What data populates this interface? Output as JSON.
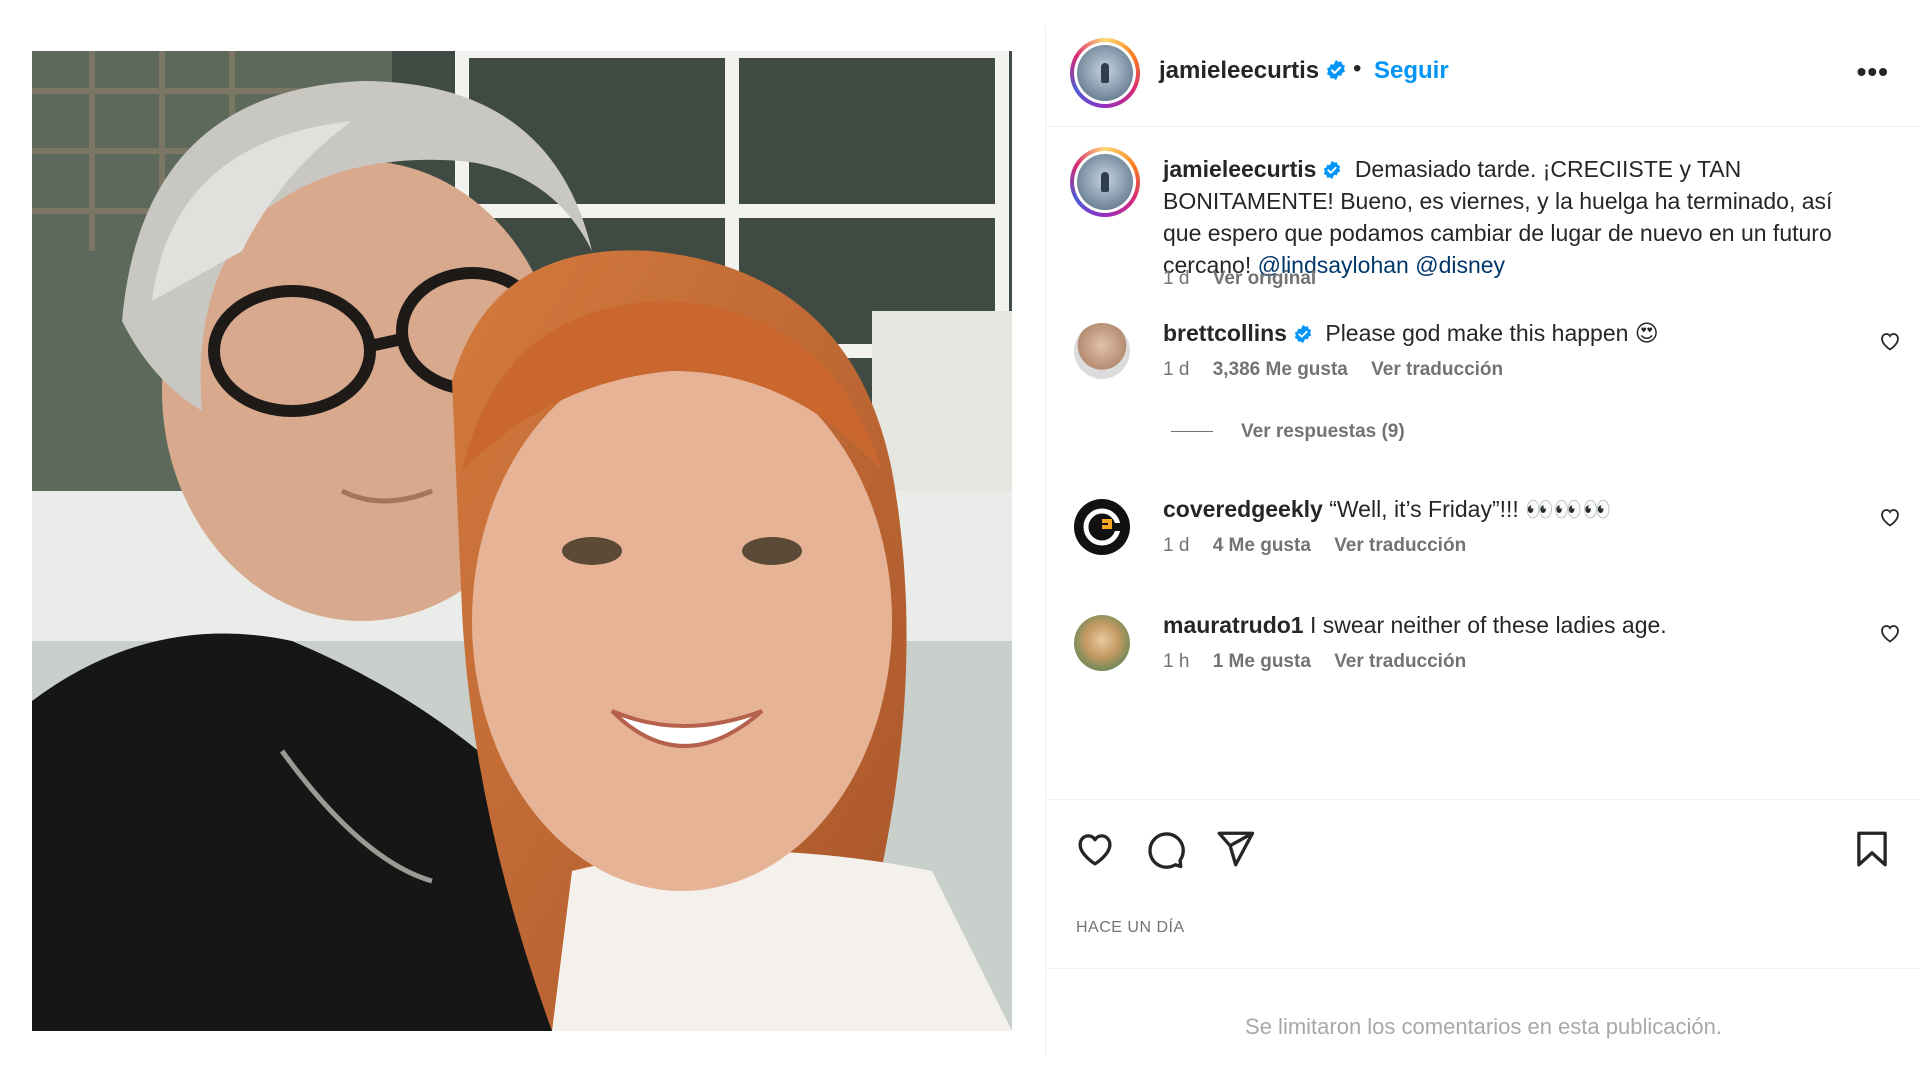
{
  "post": {
    "username": "jamieleecurtis",
    "separator": "•",
    "follow_label": "Seguir",
    "more_label": "•••"
  },
  "caption": {
    "username": "jamieleecurtis",
    "text": "Demasiado tarde. ¡CRECIISTE y TAN BONITAMENTE! Bueno, es viernes, y la huelga ha terminado, así que espero que podamos cambiar de lugar de nuevo en un futuro cercano!",
    "mention_1": "@lindsaylohan",
    "mention_2": "@disney",
    "time": "1 d",
    "see_original": "Ver original"
  },
  "comments": [
    {
      "username": "brettcollins",
      "verified": true,
      "text": "Please god make this happen 😍",
      "time": "1 d",
      "likes": "3,386 Me gusta",
      "translate": "Ver traducción",
      "replies": "Ver respuestas (9)"
    },
    {
      "username": "coveredgeekly",
      "verified": false,
      "text": "“Well, it’s Friday”!!! 👀👀👀",
      "time": "1 d",
      "likes": "4 Me gusta",
      "translate": "Ver traducción"
    },
    {
      "username": "mauratrudo1",
      "verified": false,
      "text": "I swear neither of these ladies age.",
      "time": "1 h",
      "likes": "1 Me gusta",
      "translate": "Ver traducción"
    }
  ],
  "actions": {
    "like_icon": "heart-icon",
    "comment_icon": "comment-icon",
    "share_icon": "paper-plane-icon",
    "save_icon": "bookmark-icon"
  },
  "time_ago": "HACE UN DÍA",
  "limited_comments": "Se limitaron los comentarios en esta publicación.",
  "colors": {
    "accent": "#0095f6",
    "verified": "#0095f6",
    "text": "#262626",
    "muted": "#737373",
    "mention": "#00376b"
  }
}
